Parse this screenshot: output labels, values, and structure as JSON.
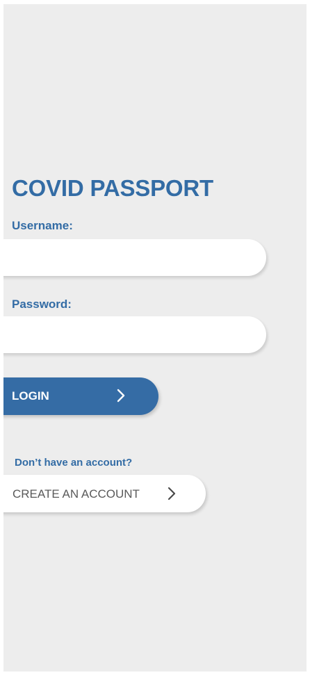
{
  "app": {
    "title": "COVID PASSPORT"
  },
  "login_form": {
    "username_label": "Username:",
    "username_value": "",
    "password_label": "Password:",
    "password_value": "",
    "login_button_label": "LOGIN",
    "login_button_icon": "chevron-right-icon"
  },
  "signup": {
    "prompt": "Don’t have an account?",
    "create_button_label": "CREATE AN ACCOUNT",
    "create_button_icon": "chevron-right-icon"
  },
  "colors": {
    "background": "#ededed",
    "accent": "#356ca5",
    "field_background": "#ffffff",
    "secondary_text": "#5a5a5a"
  }
}
